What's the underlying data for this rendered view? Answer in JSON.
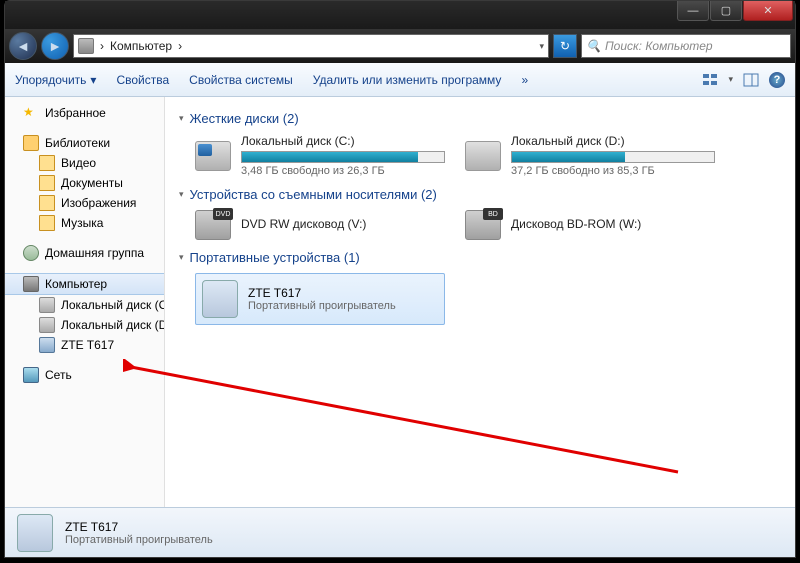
{
  "window": {
    "min": "—",
    "max": "▢",
    "close": "✕"
  },
  "nav": {
    "back": "◄",
    "forward": "►",
    "breadcrumb_root": "Компьютер",
    "sep": "›",
    "refresh": "↻",
    "search_placeholder": "Поиск: Компьютер",
    "search_icon": "🔍"
  },
  "toolbar": {
    "organize": "Упорядочить",
    "dd": "▾",
    "properties": "Свойства",
    "sysprops": "Свойства системы",
    "uninstall": "Удалить или изменить программу",
    "more": "»",
    "view_dd": "▾",
    "help": "?"
  },
  "sidebar": {
    "favorites": "Избранное",
    "libraries": "Библиотеки",
    "lib_items": {
      "video": "Видео",
      "docs": "Документы",
      "images": "Изображения",
      "music": "Музыка"
    },
    "homegroup": "Домашняя группа",
    "computer": "Компьютер",
    "drive_c": "Локальный диск (C:)",
    "drive_d": "Локальный диск (D:)",
    "device": "ZTE T617",
    "network": "Сеть"
  },
  "main": {
    "hdd_header": "Жесткие диски (2)",
    "c": {
      "name": "Локальный диск (C:)",
      "free": "3,48 ГБ свободно из 26,3 ГБ",
      "pct": 87
    },
    "d": {
      "name": "Локальный диск (D:)",
      "free": "37,2 ГБ свободно из 85,3 ГБ",
      "pct": 56
    },
    "removable_header": "Устройства со съемными носителями (2)",
    "dvd": {
      "name": "DVD RW дисковод (V:)"
    },
    "bd": {
      "name": "Дисковод BD-ROM (W:)"
    },
    "portable_header": "Портативные устройства (1)",
    "zte": {
      "name": "ZTE T617",
      "sub": "Портативный проигрыватель"
    }
  },
  "status": {
    "name": "ZTE T617",
    "sub": "Портативный проигрыватель"
  }
}
